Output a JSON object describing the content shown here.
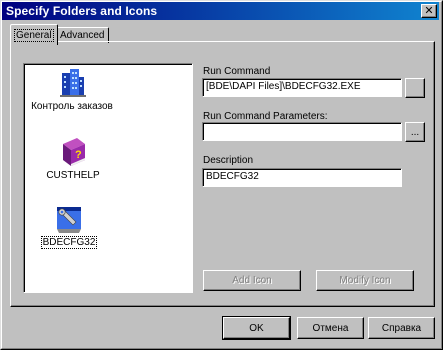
{
  "window": {
    "title": "Specify Folders and Icons",
    "close_label": "✕"
  },
  "tabs": [
    {
      "label": "General",
      "active": true
    },
    {
      "label": "Advanced",
      "active": false
    }
  ],
  "icons": [
    {
      "label": "Контроль заказов",
      "icon": "buildings-icon"
    },
    {
      "label": "CUSTHELP",
      "icon": "help-book-icon"
    },
    {
      "label": "BDECFG32",
      "icon": "wrench-config-icon",
      "selected": true
    }
  ],
  "run_command": {
    "label": "Run Command",
    "value": "[BDE\\DAPI Files]\\BDECFG32.EXE",
    "browse_label": ""
  },
  "run_params": {
    "label": "Run Command Parameters:",
    "value": "",
    "browse_label": "..."
  },
  "description": {
    "label": "Description",
    "value": "BDECFG32"
  },
  "buttons": {
    "add_icon": "Add Icon",
    "modify_icon": "Modify Icon",
    "ok": "OK",
    "cancel": "Отмена",
    "help": "Справка"
  }
}
